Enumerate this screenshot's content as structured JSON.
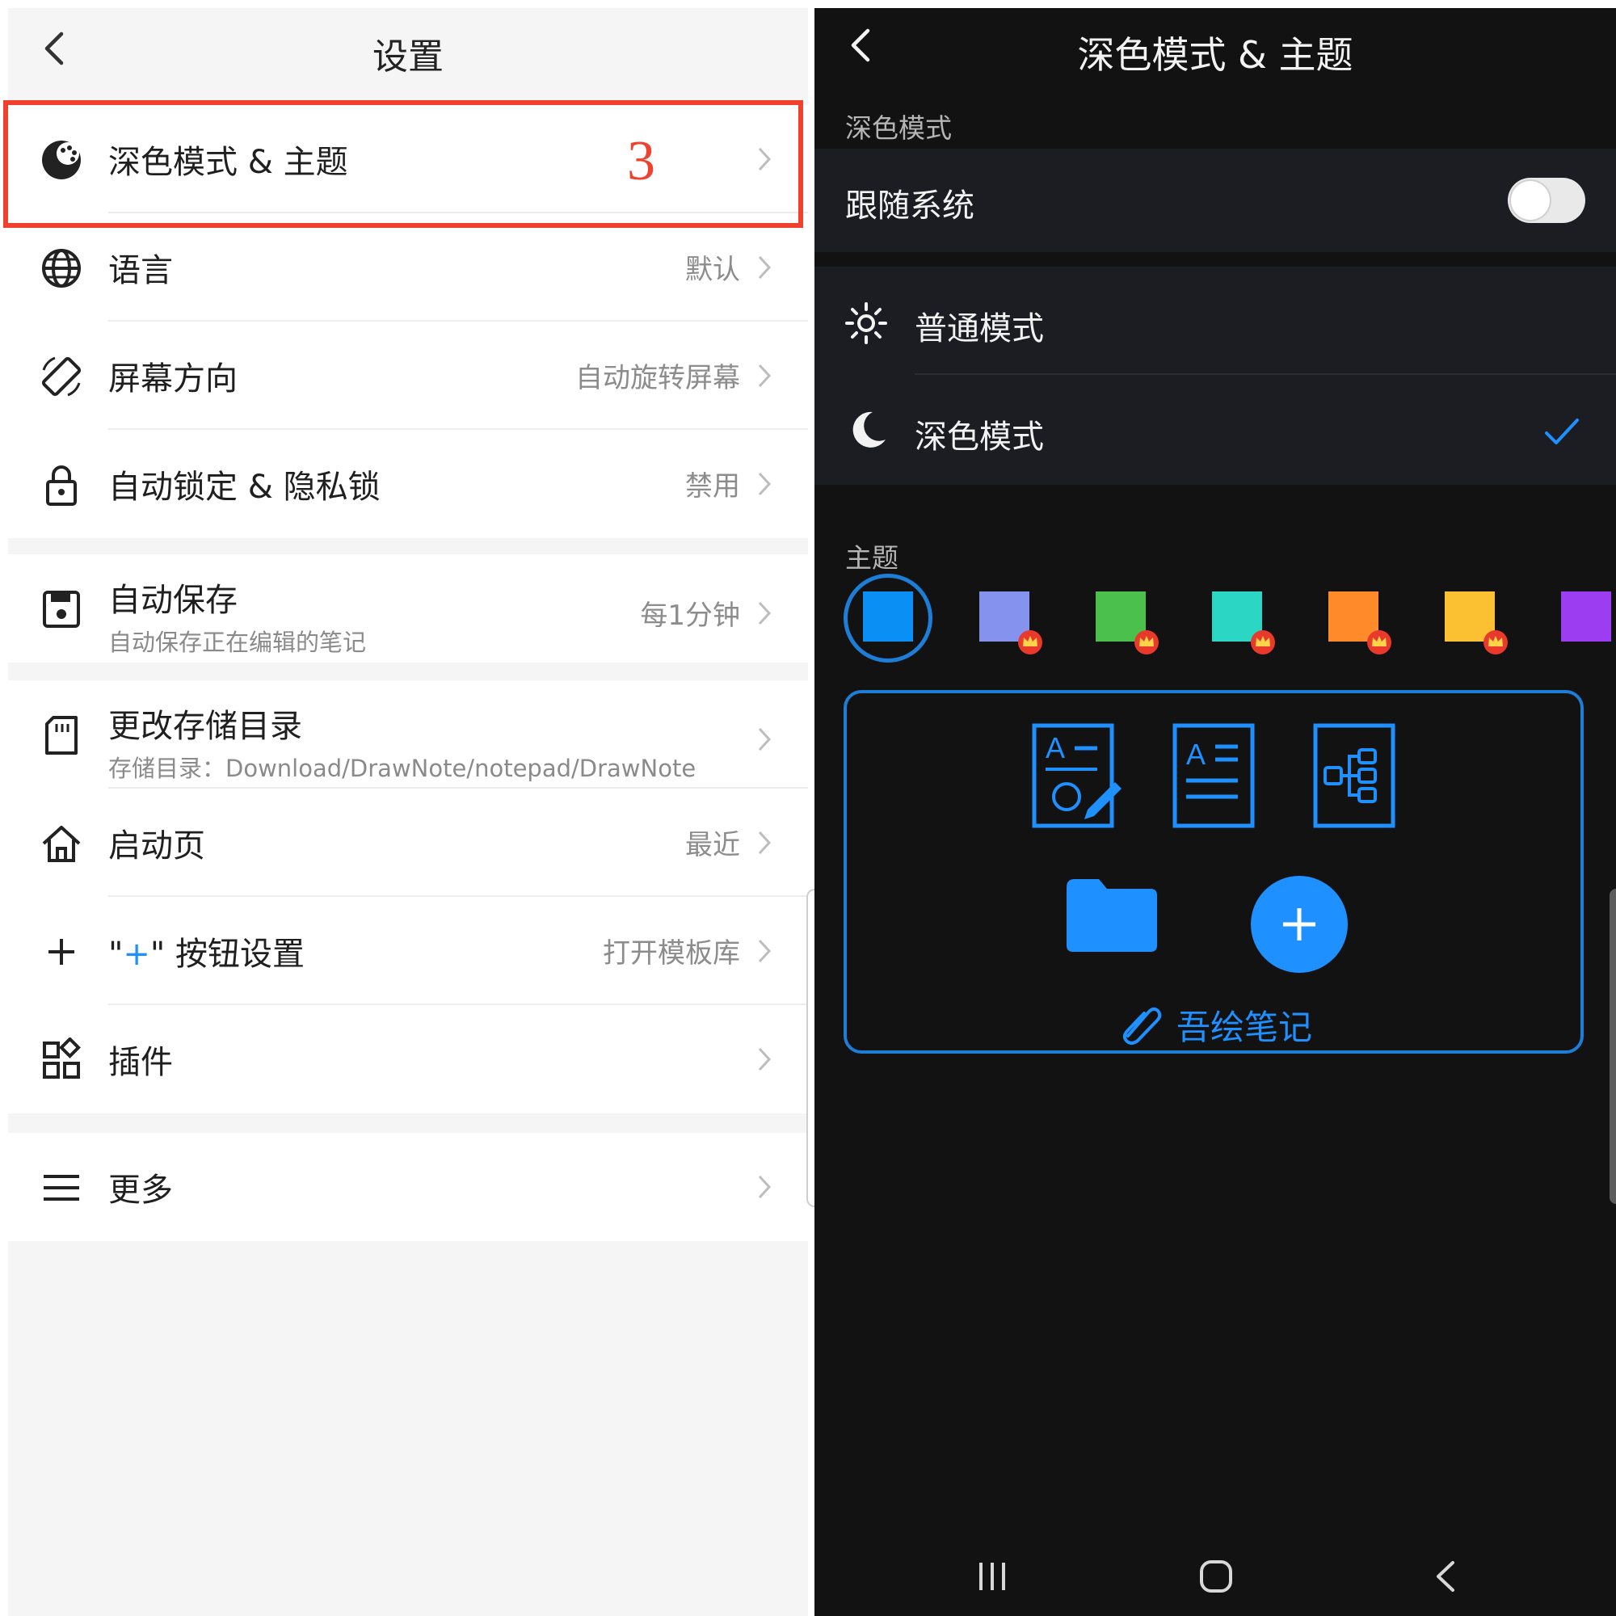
{
  "left": {
    "title": "设置",
    "step_marker": "3",
    "items": [
      {
        "label": "深色模式 & 主题",
        "value": "",
        "icon": "palette-icon"
      },
      {
        "label": "语言",
        "value": "默认",
        "icon": "globe-icon"
      },
      {
        "label": "屏幕方向",
        "value": "自动旋转屏幕",
        "icon": "screen-rotation-icon"
      },
      {
        "label": "自动锁定 & 隐私锁",
        "value": "禁用",
        "icon": "lock-icon"
      },
      {
        "label": "自动保存",
        "sub": "自动保存正在编辑的笔记",
        "value": "每1分钟",
        "icon": "save-icon"
      },
      {
        "label": "更改存储目录",
        "sub": "存储目录：Download/DrawNote/notepad/DrawNote",
        "value": "",
        "icon": "sd-card-icon"
      },
      {
        "label": "启动页",
        "value": "最近",
        "icon": "home-icon"
      },
      {
        "label_prefix": "\"",
        "label_plus": "+",
        "label_suffix": "\" 按钮设置",
        "value": "打开模板库",
        "icon": "plus-icon"
      },
      {
        "label": "插件",
        "value": "",
        "icon": "plugins-icon"
      },
      {
        "label": "更多",
        "value": "",
        "icon": "menu-icon"
      }
    ]
  },
  "right": {
    "title": "深色模式 & 主题",
    "section_dark": "深色模式",
    "follow_system": "跟随系统",
    "follow_system_on": false,
    "normal_mode": "普通模式",
    "dark_mode": "深色模式",
    "dark_mode_selected": true,
    "section_theme": "主题",
    "themes": [
      {
        "color": "#0a8ff5",
        "selected": true,
        "premium": false
      },
      {
        "color": "#8593ee",
        "selected": false,
        "premium": true
      },
      {
        "color": "#4cc04c",
        "selected": false,
        "premium": true
      },
      {
        "color": "#2bd6c4",
        "selected": false,
        "premium": true
      },
      {
        "color": "#fe8a2a",
        "selected": false,
        "premium": true
      },
      {
        "color": "#fcc033",
        "selected": false,
        "premium": true
      },
      {
        "color": "#9c3df2",
        "selected": false,
        "premium": true
      }
    ],
    "preview_brand": "吾绘笔记",
    "accent": "#1e90ff"
  }
}
